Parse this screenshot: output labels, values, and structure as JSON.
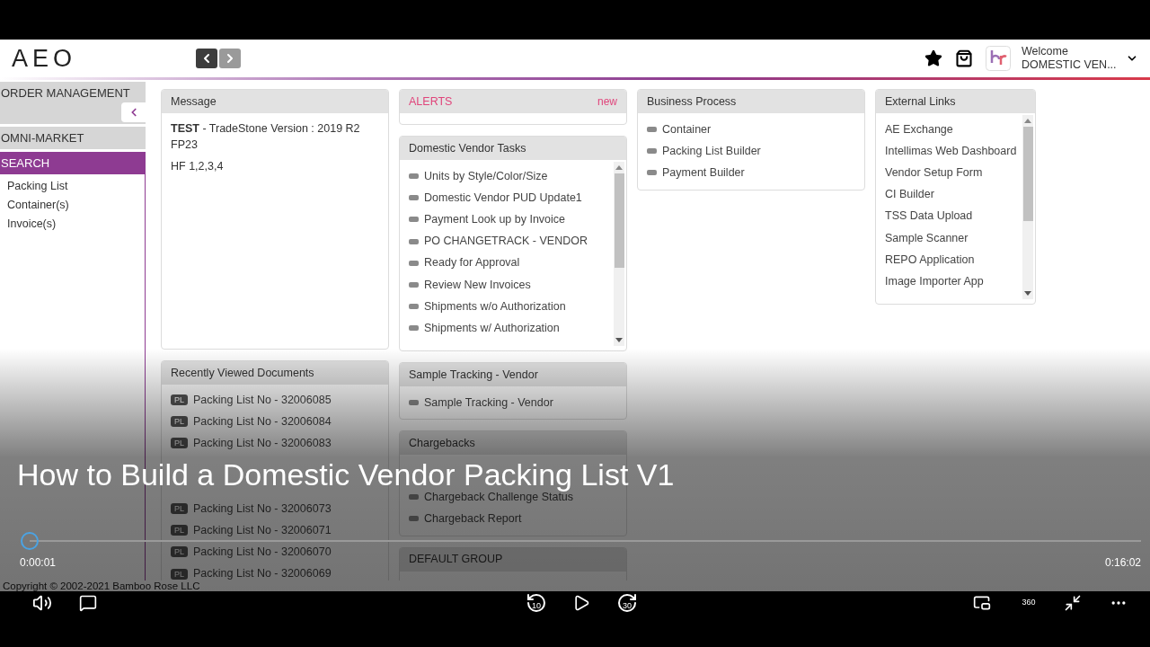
{
  "header": {
    "logo": "AEO",
    "welcome": "Welcome",
    "user": "DOMESTIC VEN..."
  },
  "sidebar": {
    "sections": [
      {
        "label": "ORDER MANAGEMENT",
        "selected": false,
        "collapse_button": true
      },
      {
        "label": "OMNI-MARKET",
        "selected": false
      },
      {
        "label": "SEARCH",
        "selected": true,
        "items": [
          "Packing List",
          "Container(s)",
          "Invoice(s)"
        ]
      }
    ]
  },
  "columns": [
    [
      {
        "kind": "message",
        "title": "Message",
        "lines": [
          "**TEST** - TradeStone Version : 2019 R2 FP23",
          "HF 1,2,3,4"
        ]
      },
      {
        "kind": "documents",
        "title": "Recently Viewed Documents",
        "items_before_gap": [
          {
            "tag": "PL",
            "label": "Packing List No - 32006085"
          },
          {
            "tag": "PL",
            "label": "Packing List No - 32006084"
          },
          {
            "tag": "PL",
            "label": "Packing List No - 32006083"
          }
        ],
        "items_after_gap": [
          {
            "tag": "PL",
            "label": "Packing List No - 32006073"
          },
          {
            "tag": "PL",
            "label": "Packing List No - 32006071"
          },
          {
            "tag": "PL",
            "label": "Packing List No - 32006070"
          },
          {
            "tag": "PL",
            "label": "Packing List No - 32006069"
          }
        ]
      }
    ],
    [
      {
        "kind": "alert",
        "title": "ALERTS",
        "badge": "new"
      },
      {
        "kind": "list",
        "title": "Domestic Vendor Tasks",
        "scrollable": true,
        "items": [
          "Units by Style/Color/Size",
          "Domestic Vendor PUD Update1",
          "Payment Look up by Invoice",
          "PO CHANGETRACK - VENDOR",
          "Ready for Approval",
          "Review New Invoices",
          "Shipments w/o Authorization",
          "Shipments w/ Authorization"
        ]
      },
      {
        "kind": "list",
        "title": "Sample Tracking - Vendor",
        "items": [
          "Sample Tracking - Vendor"
        ]
      },
      {
        "kind": "list_after_gap",
        "title": "Chargebacks",
        "items": [
          "Chargeback Challenge Status",
          "Chargeback Report"
        ]
      },
      {
        "kind": "header_only",
        "title": "DEFAULT GROUP"
      }
    ],
    [
      {
        "kind": "list",
        "title": "Business Process",
        "items": [
          "Container",
          "Packing List Builder",
          "Payment Builder"
        ]
      }
    ],
    [
      {
        "kind": "links",
        "title": "External Links",
        "scrollable": true,
        "items": [
          "AE Exchange",
          "Intellimas Web Dashboard",
          "Vendor Setup Form",
          "CI Builder",
          "TSS Data Upload",
          "Sample Scanner",
          "REPO Application",
          "Image Importer App"
        ]
      }
    ]
  ],
  "footer": {
    "copyright": "Copyright © 2002-2021 Bamboo Rose LLC"
  },
  "player": {
    "title": "How to Build a Domestic Vendor Packing List V1",
    "elapsed": "0:00:01",
    "duration": "0:16:02",
    "level": 0,
    "rewind": "10",
    "forward": "30",
    "vr": "360"
  }
}
